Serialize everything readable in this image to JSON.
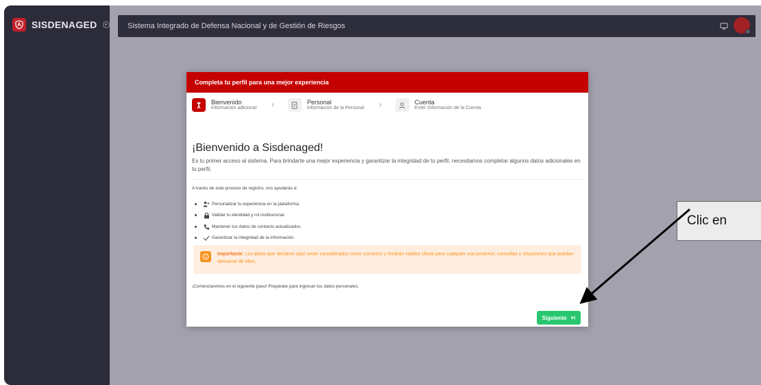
{
  "sidebar": {
    "brand": "SISDENAGED"
  },
  "topbar": {
    "title": "Sistema Integrado de Defensa Nacional y de Gestión de Riesgos"
  },
  "modal": {
    "header": "Completa tu perfil para una mejor experiencia",
    "steps": [
      {
        "title": "Bienvenido",
        "subtitle": "Información adicional",
        "icon": "hand-wave-icon",
        "active": true
      },
      {
        "title": "Personal",
        "subtitle": "Información de la Personal",
        "icon": "document-icon",
        "active": false
      },
      {
        "title": "Cuenta",
        "subtitle": "Enter Información de la Cuenta",
        "icon": "user-icon",
        "active": false
      }
    ],
    "welcome_title": "¡Bienvenido a Sisdenaged!",
    "welcome_desc": "Es tu primer acceso al sistema. Para brindarte una mejor experiencia y garantizar la integridad de tu perfil, necesitamos completar algunos datos adicionales en tu perfil.",
    "intro": "A través de este proceso de registro, nos ayudarás a:",
    "bullets": [
      {
        "icon": "user-add-icon",
        "text": "Personalizar tu experiencia en la plataforma."
      },
      {
        "icon": "lock-icon",
        "text": "Validar tu identidad y rol institucional."
      },
      {
        "icon": "phone-icon",
        "text": "Mantener tus datos de contacto actualizados."
      },
      {
        "icon": "check-icon",
        "text": "Garantizar la integridad de la información."
      }
    ],
    "alert_strong": "Importante:",
    "alert_text": "Los datos que declares aquí serán considerados como correctos y tendrán validez oficial para cualquier uso posterior, consultas o situaciones que puedan derivarse de ellos.",
    "closing": "¡Comenzaremos en el siguiente paso! Prepárate para ingresar tus datos personales.",
    "next_label": "Siguiente"
  },
  "callout": {
    "text": "Clic en"
  },
  "colors": {
    "brand_red": "#c50000",
    "success_green": "#28c76f",
    "warning_orange": "#f7931e",
    "sidebar_bg": "#2b2b3a",
    "main_bg": "#a3a1ad"
  }
}
